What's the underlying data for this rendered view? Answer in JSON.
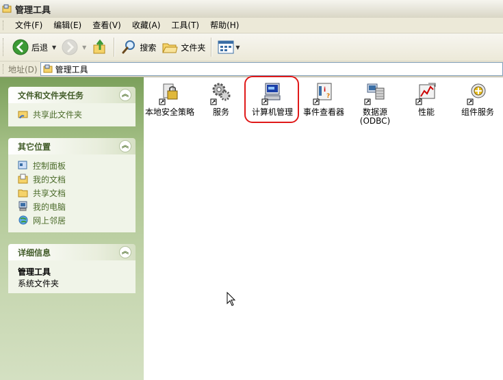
{
  "window": {
    "title": "管理工具"
  },
  "menu": [
    "文件(F)",
    "编辑(E)",
    "查看(V)",
    "收藏(A)",
    "工具(T)",
    "帮助(H)"
  ],
  "toolbar": {
    "back_label": "后退",
    "search_label": "搜索",
    "folders_label": "文件夹"
  },
  "address": {
    "label": "地址(D)",
    "value": "管理工具"
  },
  "panels": {
    "tasks": {
      "title": "文件和文件夹任务",
      "items": [
        "共享此文件夹"
      ]
    },
    "places": {
      "title": "其它位置",
      "items": [
        "控制面板",
        "我的文档",
        "共享文档",
        "我的电脑",
        "网上邻居"
      ]
    },
    "details": {
      "title": "详细信息",
      "name": "管理工具",
      "type": "系统文件夹"
    }
  },
  "files": [
    {
      "label": "本地安全策略",
      "icon": "local-security-policy-icon"
    },
    {
      "label": "服务",
      "icon": "services-icon"
    },
    {
      "label": "计算机管理",
      "icon": "computer-management-icon"
    },
    {
      "label": "事件查看器",
      "icon": "event-viewer-icon"
    },
    {
      "label": "数据源\n(ODBC)",
      "icon": "odbc-datasource-icon"
    },
    {
      "label": "性能",
      "icon": "performance-icon"
    },
    {
      "label": "组件服务",
      "icon": "component-services-icon"
    }
  ],
  "colors": {
    "accent": "#316ac5",
    "highlight": "#e01818",
    "task_link": "#4b6b2a",
    "pane_green": "#a8c28a"
  }
}
